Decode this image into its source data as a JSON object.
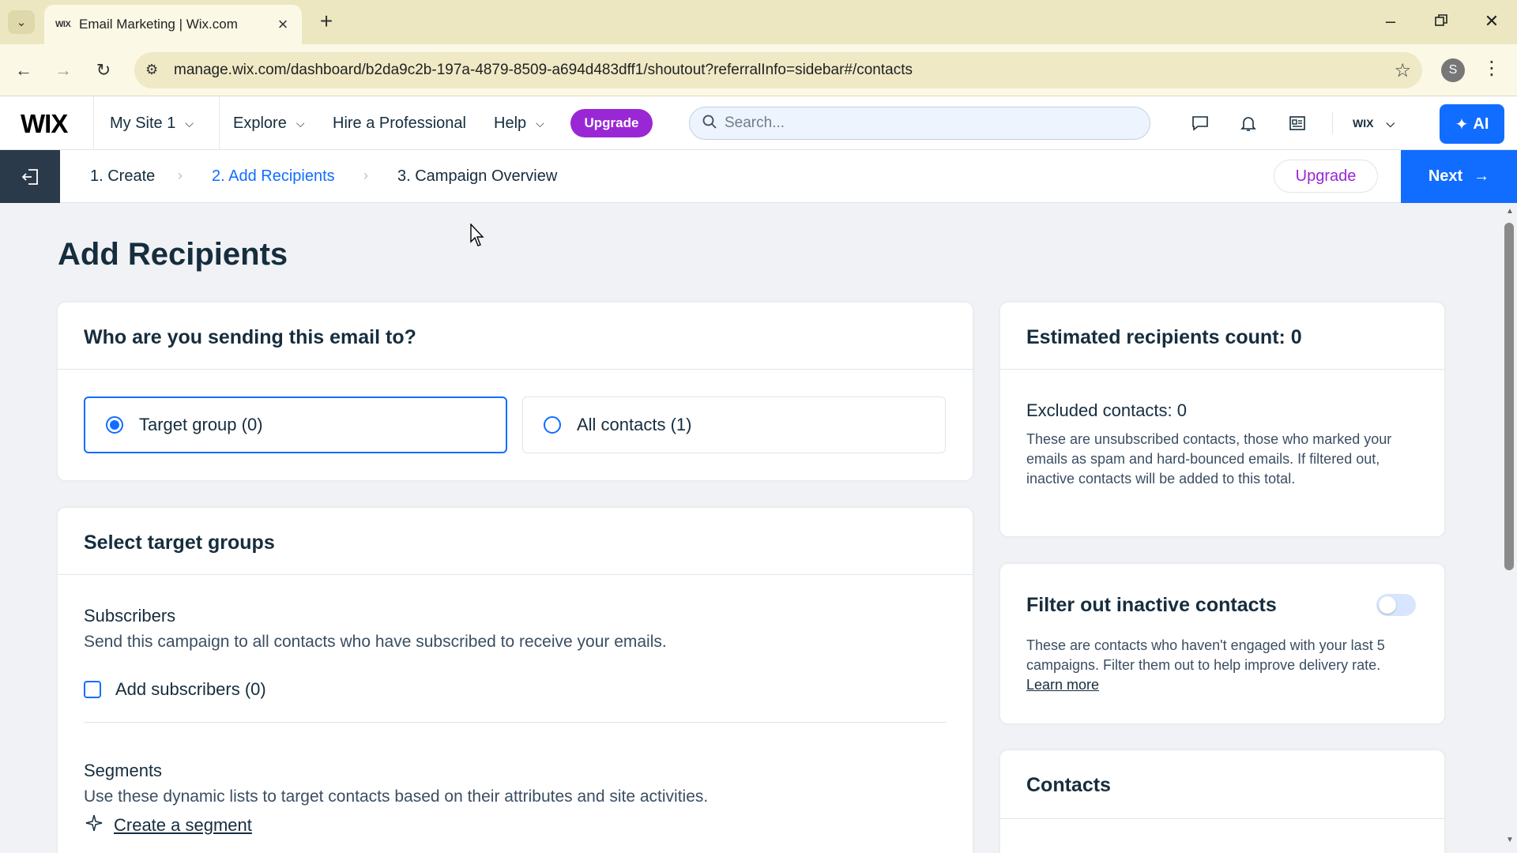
{
  "browser": {
    "tab_title": "Email Marketing | Wix.com",
    "tab_favicon": "WIX",
    "url": "manage.wix.com/dashboard/b2da9c2b-197a-4879-8509-a694d483dff1/shoutout?referralInfo=sidebar#/contacts",
    "profile_initial": "S"
  },
  "wix_bar": {
    "logo": "WIX",
    "site_name": "My Site 1",
    "nav": {
      "explore": "Explore",
      "hire": "Hire a Professional",
      "help": "Help"
    },
    "upgrade_label": "Upgrade",
    "search_placeholder": "Search...",
    "account_label": "WIX",
    "ai_label": "AI"
  },
  "steps": {
    "items": [
      "1. Create",
      "2. Add Recipients",
      "3. Campaign Overview"
    ],
    "active_index": 1,
    "upgrade_label": "Upgrade",
    "next_label": "Next"
  },
  "main": {
    "page_title": "Add Recipients",
    "who_card": {
      "title": "Who are you sending this email to?",
      "options": [
        {
          "label": "Target group (0)",
          "selected": true
        },
        {
          "label": "All contacts (1)",
          "selected": false
        }
      ]
    },
    "target_card": {
      "title": "Select target groups",
      "subscribers_title": "Subscribers",
      "subscribers_desc": "Send this campaign to all contacts who have subscribed to receive your emails.",
      "add_subscribers_label": "Add subscribers (0)",
      "segments_title": "Segments",
      "segments_desc": "Use these dynamic lists to target contacts based on their attributes and site activities.",
      "create_segment_label": "Create a segment"
    }
  },
  "side": {
    "estimate_card": {
      "title": "Estimated recipients count: 0",
      "excluded_label": "Excluded contacts: 0",
      "excluded_desc": "These are unsubscribed contacts, those who marked your emails as spam and hard-bounced emails. If filtered out, inactive contacts will be added to this total."
    },
    "filter_card": {
      "title": "Filter out inactive contacts",
      "desc": "These are contacts who haven't engaged with your last 5 campaigns. Filter them out to help improve delivery rate.",
      "learn_more": "Learn more",
      "toggle_on": false
    },
    "contacts_card": {
      "title": "Contacts"
    }
  },
  "colors": {
    "accent": "#116dff",
    "upgrade": "#9a27d5",
    "text": "#162d3d"
  }
}
